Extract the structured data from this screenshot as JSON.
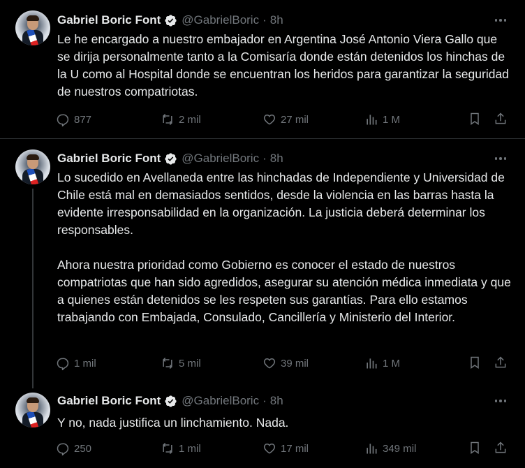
{
  "tweets": [
    {
      "name": "Gabriel Boric Font",
      "handle": "@GabrielBoric",
      "separator": "·",
      "time": "8h",
      "text": "Le he encargado a nuestro embajador en Argentina José Antonio Viera Gallo que se dirija personalmente tanto a la Comisaría donde están detenidos los hinchas de la U como al Hospital donde se encuentran los heridos para garantizar la seguridad de nuestros compatriotas.",
      "replies": "877",
      "reposts": "2 mil",
      "likes": "27 mil",
      "views": "1 M"
    },
    {
      "name": "Gabriel Boric Font",
      "handle": "@GabrielBoric",
      "separator": "·",
      "time": "8h",
      "text": "Lo sucedido en Avellaneda entre las hinchadas de Independiente y Universidad de Chile está mal en demasiados sentidos, desde la violencia en las barras hasta la evidente irresponsabilidad en la organización. La justicia deberá determinar los responsables.\n\nAhora nuestra prioridad como Gobierno es conocer el estado de nuestros compatriotas que han sido agredidos, asegurar su atención médica inmediata y que a quienes están detenidos se les respeten sus garantías. Para ello estamos trabajando con Embajada, Consulado, Cancillería y Ministerio del Interior.",
      "replies": "1 mil",
      "reposts": "5 mil",
      "likes": "39 mil",
      "views": "1 M"
    },
    {
      "name": "Gabriel Boric Font",
      "handle": "@GabrielBoric",
      "separator": "·",
      "time": "8h",
      "text": "Y no, nada justifica un linchamiento. Nada.",
      "replies": "250",
      "reposts": "1 mil",
      "likes": "17 mil",
      "views": "349 mil"
    }
  ],
  "icons": {
    "verified": "verified-badge-icon",
    "more": "more-dots-icon",
    "reply": "reply-icon",
    "repost": "repost-icon",
    "like": "heart-icon",
    "views": "views-chart-icon",
    "bookmark": "bookmark-icon",
    "share": "share-icon"
  },
  "colors": {
    "background": "#000000",
    "text": "#e7e9ea",
    "secondary": "#71767b",
    "verified": "#1d9bf0"
  }
}
